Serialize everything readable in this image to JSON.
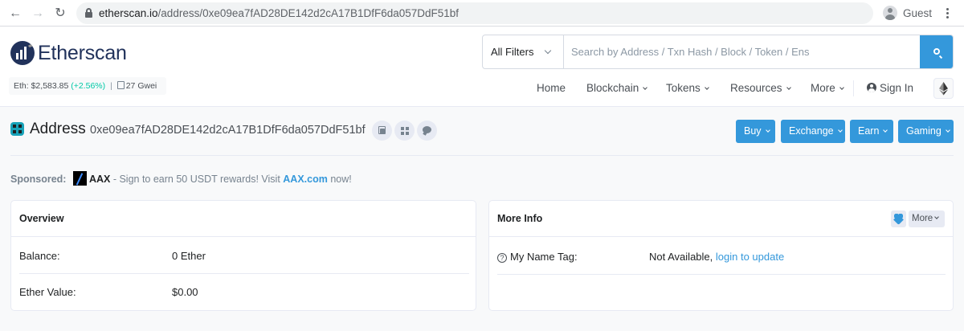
{
  "browser": {
    "url_domain": "etherscan.io",
    "url_path": "/address/0xe09ea7fAD28DE142d2cA17B1DfF6da057DdF51bf",
    "profile_name": "Guest"
  },
  "header": {
    "logo_text": "Etherscan",
    "eth_price_label": "Eth: $2,583.85",
    "eth_change": "(+2.56%)",
    "separator": "|",
    "gas": "27 Gwei",
    "search": {
      "filter_label": "All Filters",
      "placeholder": "Search by Address / Txn Hash / Block / Token / Ens"
    },
    "nav": {
      "home": "Home",
      "blockchain": "Blockchain",
      "tokens": "Tokens",
      "resources": "Resources",
      "more": "More",
      "sign_in": "Sign In"
    }
  },
  "page": {
    "title": "Address",
    "address": "0xe09ea7fAD28DE142d2cA17B1DfF6da057DdF51bf",
    "actions": {
      "buy": "Buy",
      "exchange": "Exchange",
      "earn": "Earn",
      "gaming": "Gaming"
    },
    "sponsored": {
      "label": "Sponsored:",
      "dash": "-",
      "brand": "AAX",
      "text": "- Sign to earn 50 USDT rewards! Visit",
      "link": "AAX.com",
      "suffix": "now!"
    }
  },
  "overview": {
    "title": "Overview",
    "balance_label": "Balance:",
    "balance_value": "0 Ether",
    "ether_value_label": "Ether Value:",
    "ether_value": "$0.00"
  },
  "more_info": {
    "title": "More Info",
    "more_button": "More",
    "name_tag_label": "My Name Tag:",
    "name_tag_value": "Not Available,",
    "name_tag_link": "login to update"
  },
  "colors": {
    "accent": "#3498db",
    "brand_navy": "#21325b",
    "positive": "#00c9a7"
  }
}
